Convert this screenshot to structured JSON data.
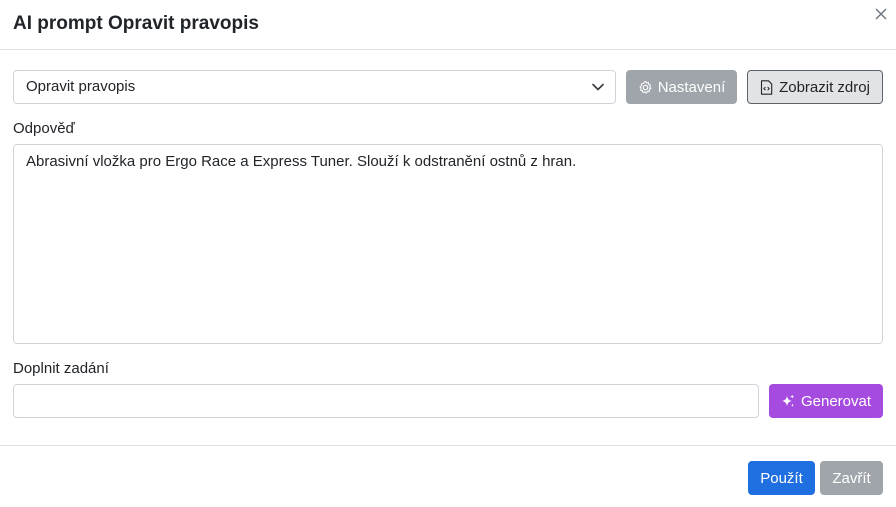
{
  "dialog": {
    "title": "AI prompt Opravit pravopis"
  },
  "prompt_select": {
    "selected": "Opravit pravopis"
  },
  "toolbar": {
    "settings_label": "Nastavení",
    "view_source_label": "Zobrazit zdroj"
  },
  "response": {
    "label": "Odpověď",
    "text": "Abrasivní vložka pro Ergo Race a Express Tuner. Slouží k odstranění ostnů z hran."
  },
  "supplement": {
    "label": "Doplnit zadání",
    "value": "",
    "placeholder": "",
    "generate_label": "Generovat"
  },
  "footer": {
    "apply_label": "Použít",
    "close_label": "Zavřít"
  },
  "colors": {
    "primary": "#1f6fe0",
    "secondary": "#a0a5ab",
    "generate": "#a64be0"
  }
}
